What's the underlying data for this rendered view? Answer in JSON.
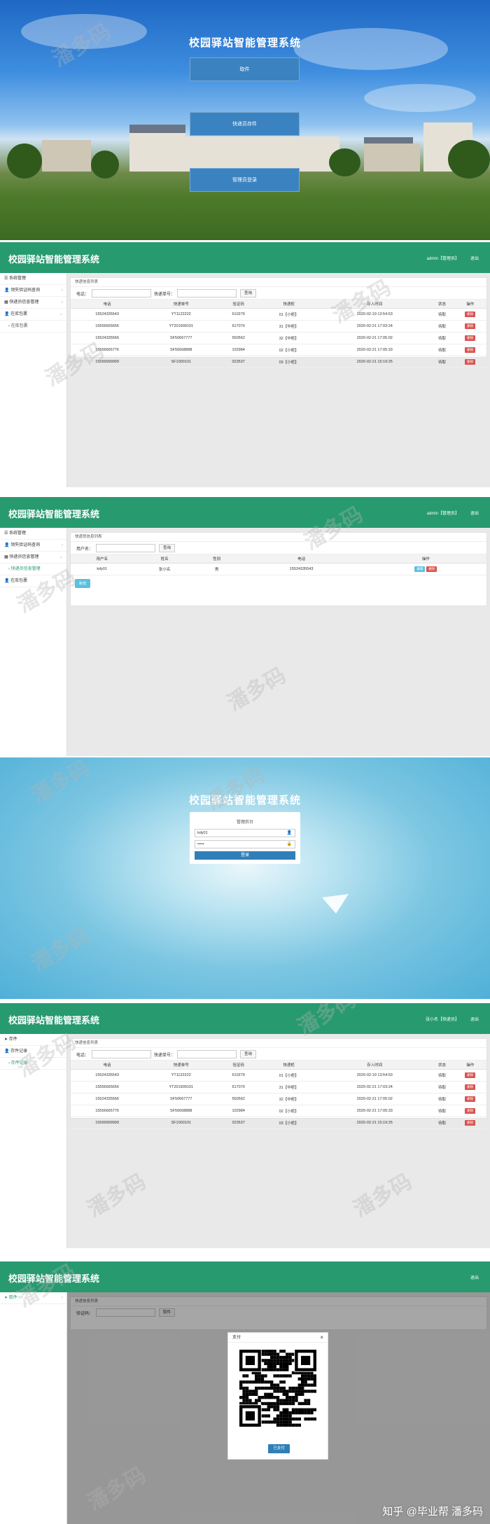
{
  "app_title": "校园驿站智能管理系统",
  "landing": {
    "buttons": [
      "取件",
      "快递员存件",
      "管理员登录"
    ]
  },
  "admin_header": {
    "user": "admin【管理员】",
    "logout": "退出"
  },
  "admin_sidebar": [
    {
      "label": "系统管理",
      "icon": "list-icon"
    },
    {
      "label": "领失验证码查询",
      "icon": "user-icon"
    },
    {
      "label": "快递员信息管理",
      "icon": "grid-icon"
    },
    {
      "label": "在库包裹",
      "icon": "user-icon"
    }
  ],
  "admin_sidebar_sub": "在库包裹",
  "parcel_list": {
    "card_title": "快递信息列表",
    "search_phone_label": "电话：",
    "search_tracking_label": "快递单号：",
    "search_button": "查询",
    "headers": [
      "电话",
      "快递单号",
      "验证码",
      "快递柜",
      "存入时间",
      "状态",
      "操作"
    ],
    "rows": [
      [
        "15524335543",
        "YT1122222",
        "610279",
        "01【小柜】",
        "2020-02-19 13:54:53",
        "待取",
        "删除"
      ],
      [
        "15556665656",
        "YT201909191",
        "617070",
        "31【中柜】",
        "2020-02-21 17:03:24",
        "待取",
        "删除"
      ],
      [
        "15524335566",
        "SF50667777",
        "550562",
        "32【中柜】",
        "2020-02-21 17:05:02",
        "待取",
        "删除"
      ],
      [
        "15556665776",
        "SF55668888",
        "102984",
        "02【小柜】",
        "2020-02-21 17:05:33",
        "待取",
        "删除"
      ],
      [
        "15599999999",
        "SF1000101",
        "023537",
        "03【小柜】",
        "2020-02-21 15:19:25",
        "待取",
        "删除"
      ]
    ]
  },
  "courier_sidebar": [
    {
      "label": "系统管理",
      "icon": "list-icon"
    },
    {
      "label": "领失验证码查询",
      "icon": "user-icon"
    },
    {
      "label": "快递员信息管理",
      "icon": "grid-icon"
    }
  ],
  "courier_sidebar_sub": "快递员信息管理",
  "courier_sidebar_after": {
    "label": "在库包裹",
    "icon": "user-icon"
  },
  "courier_list": {
    "card_title": "快递员信息列表",
    "search_label": "用户名：",
    "search_button": "查询",
    "headers": [
      "用户名",
      "姓名",
      "性别",
      "电话",
      "操作"
    ],
    "rows": [
      [
        "kdy01",
        "张小名",
        "男",
        "15524335543"
      ]
    ],
    "edit": "编辑",
    "delete": "删除",
    "add": "新增"
  },
  "login": {
    "box_title": "管理后台",
    "username": "kdy01",
    "password_mask": "•••••",
    "submit": "登录"
  },
  "courier_header": {
    "user": "张小名【快递员】",
    "logout": "退出"
  },
  "courier_menu": [
    {
      "label": "存件",
      "icon": "send-icon"
    },
    {
      "label": "存件记录",
      "icon": "user-icon"
    }
  ],
  "courier_menu_sub": "存件记录",
  "pickup": {
    "logout": "退出",
    "menu_item": "取件",
    "card_title": "快递信息列表",
    "code_label": "验证码：",
    "button": "取件",
    "modal_title": "支付",
    "pay_button": "已支付"
  },
  "watermark": "潘多码",
  "credit": "知乎 @毕业帮 潘多码"
}
